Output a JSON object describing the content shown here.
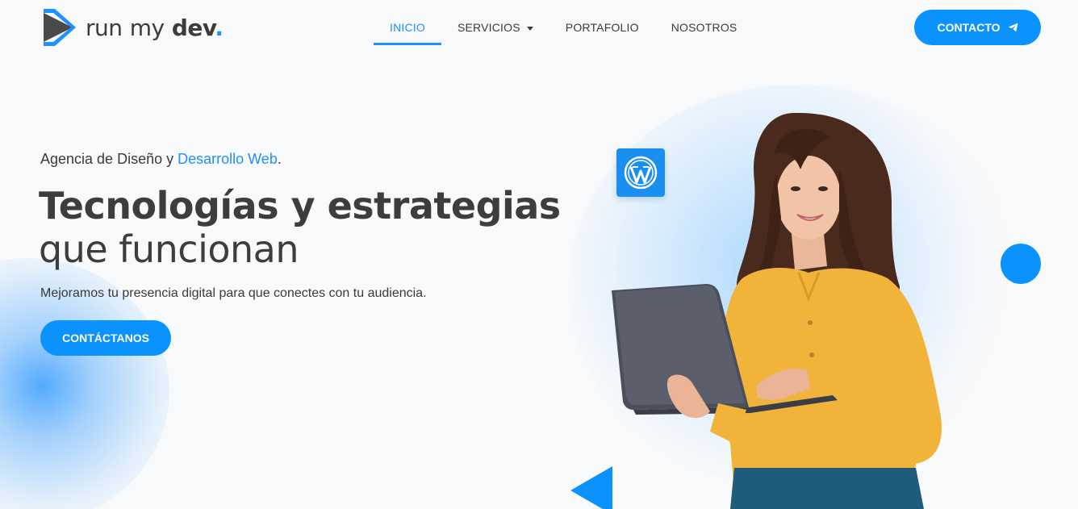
{
  "brand": {
    "logo_text_a": "run",
    "logo_text_b": "my",
    "logo_text_c": "dev",
    "logo_dot": ".",
    "accent": "#1e90ff",
    "button_color": "#0a93ff"
  },
  "nav": {
    "items": [
      {
        "label": "INICIO",
        "active": true
      },
      {
        "label": "SERVICIOS",
        "active": false,
        "has_dropdown": true
      },
      {
        "label": "PORTAFOLIO",
        "active": false
      },
      {
        "label": "NOSOTROS",
        "active": false
      }
    ],
    "contact_label": "CONTACTO",
    "contact_icon": "paper-plane-icon"
  },
  "hero": {
    "tagline_prefix": "Agencia de Diseño y ",
    "tagline_highlight": "Desarrollo Web",
    "tagline_suffix": ".",
    "headline_line1": "Tecnologías y estrategias",
    "headline_line2": "que funcionan",
    "subtext": "Mejoramos tu presencia digital para que conectes con tu audiencia.",
    "cta_label": "CONTÁCTANOS",
    "badge_icon": "wordpress-icon"
  }
}
